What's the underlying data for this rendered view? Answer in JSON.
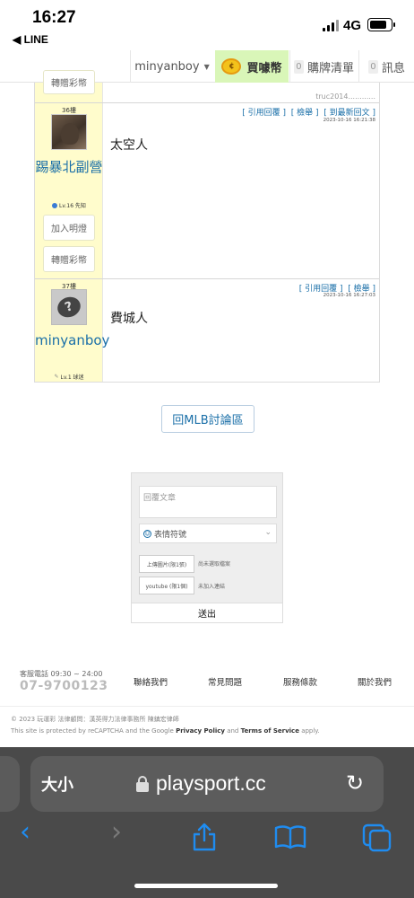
{
  "status_bar": {
    "time": "16:27",
    "back_app": "◀ LINE",
    "network": "4G",
    "battery_level_pct": 88
  },
  "topnav": {
    "username": "minyanboy",
    "buy_label": "買噱幣",
    "cart_count": "0",
    "cart_label": "購牌清單",
    "msg_count": "0",
    "msg_label": "訊息"
  },
  "posts": {
    "prev_button": "轉贈彩幣",
    "prev_signature": "truc2014............",
    "items": [
      {
        "floor": "36樓",
        "username": "踢暴北副營",
        "level": "Lv.16 先知",
        "add_button": "加入明燈",
        "gift_button": "轉贈彩幣",
        "quote": "[ 引用回覆 ]",
        "report": "[ 檢舉 ]",
        "latest": "[ 到最新回文 ]",
        "timestamp": "2023-10-16 16:21:38",
        "text": "太空人"
      },
      {
        "floor": "37樓",
        "username": "minyanboy",
        "level": "Lv.1 球迷",
        "quote": "[ 引用回覆 ]",
        "report": "[ 檢舉 ]",
        "timestamp": "2023-10-16 16:27:03",
        "text": "費城人"
      }
    ]
  },
  "back_forum": "回MLB討論區",
  "reply": {
    "placeholder": "回覆文章",
    "emoji_label": "表情符號",
    "upload_image": "上傳圖片(限1張)",
    "upload_note": "尚未選取檔案",
    "youtube": "youtube (限1個)",
    "youtube_note": "未加入連結",
    "send": "送出"
  },
  "footer": {
    "phone_label": "客服電話 09:30 ~ 24:00",
    "phone": "07-9700123",
    "links": [
      "聯絡我們",
      "常見問題",
      "服務條款",
      "關於我們"
    ],
    "copyright": "© 2023 玩運彩 法律顧問：漢英得力法律事務所 陳鎮宏律師",
    "captcha_prefix": "This site is protected by reCAPTCHA and the Google",
    "privacy": "Privacy Policy",
    "and": "and",
    "terms": "Terms of Service",
    "apply": "apply."
  },
  "safari": {
    "text_size": "大小",
    "domain": "playsport.cc"
  }
}
